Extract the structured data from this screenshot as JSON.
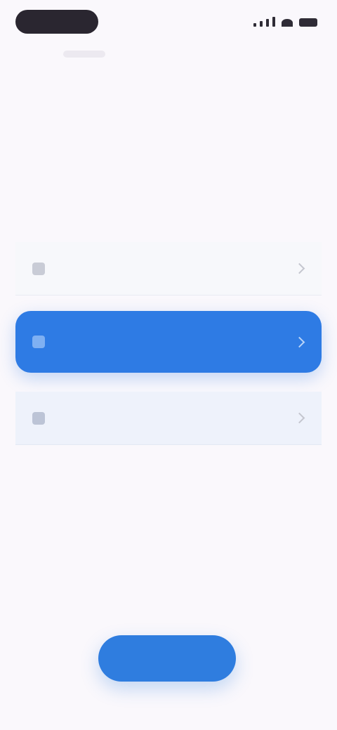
{
  "status_bar": {
    "time": ""
  },
  "content": {
    "title": "",
    "subtitle": ""
  },
  "options": [
    {
      "label": "",
      "icon": "option-icon"
    },
    {
      "label": "",
      "icon": "option-icon",
      "selected": true
    },
    {
      "label": "",
      "icon": "option-icon"
    }
  ],
  "footer": {
    "continue_label": ""
  },
  "colors": {
    "accent": "#2e7be4",
    "background": "#faf8fc",
    "selected_option": "#2e7be4"
  }
}
